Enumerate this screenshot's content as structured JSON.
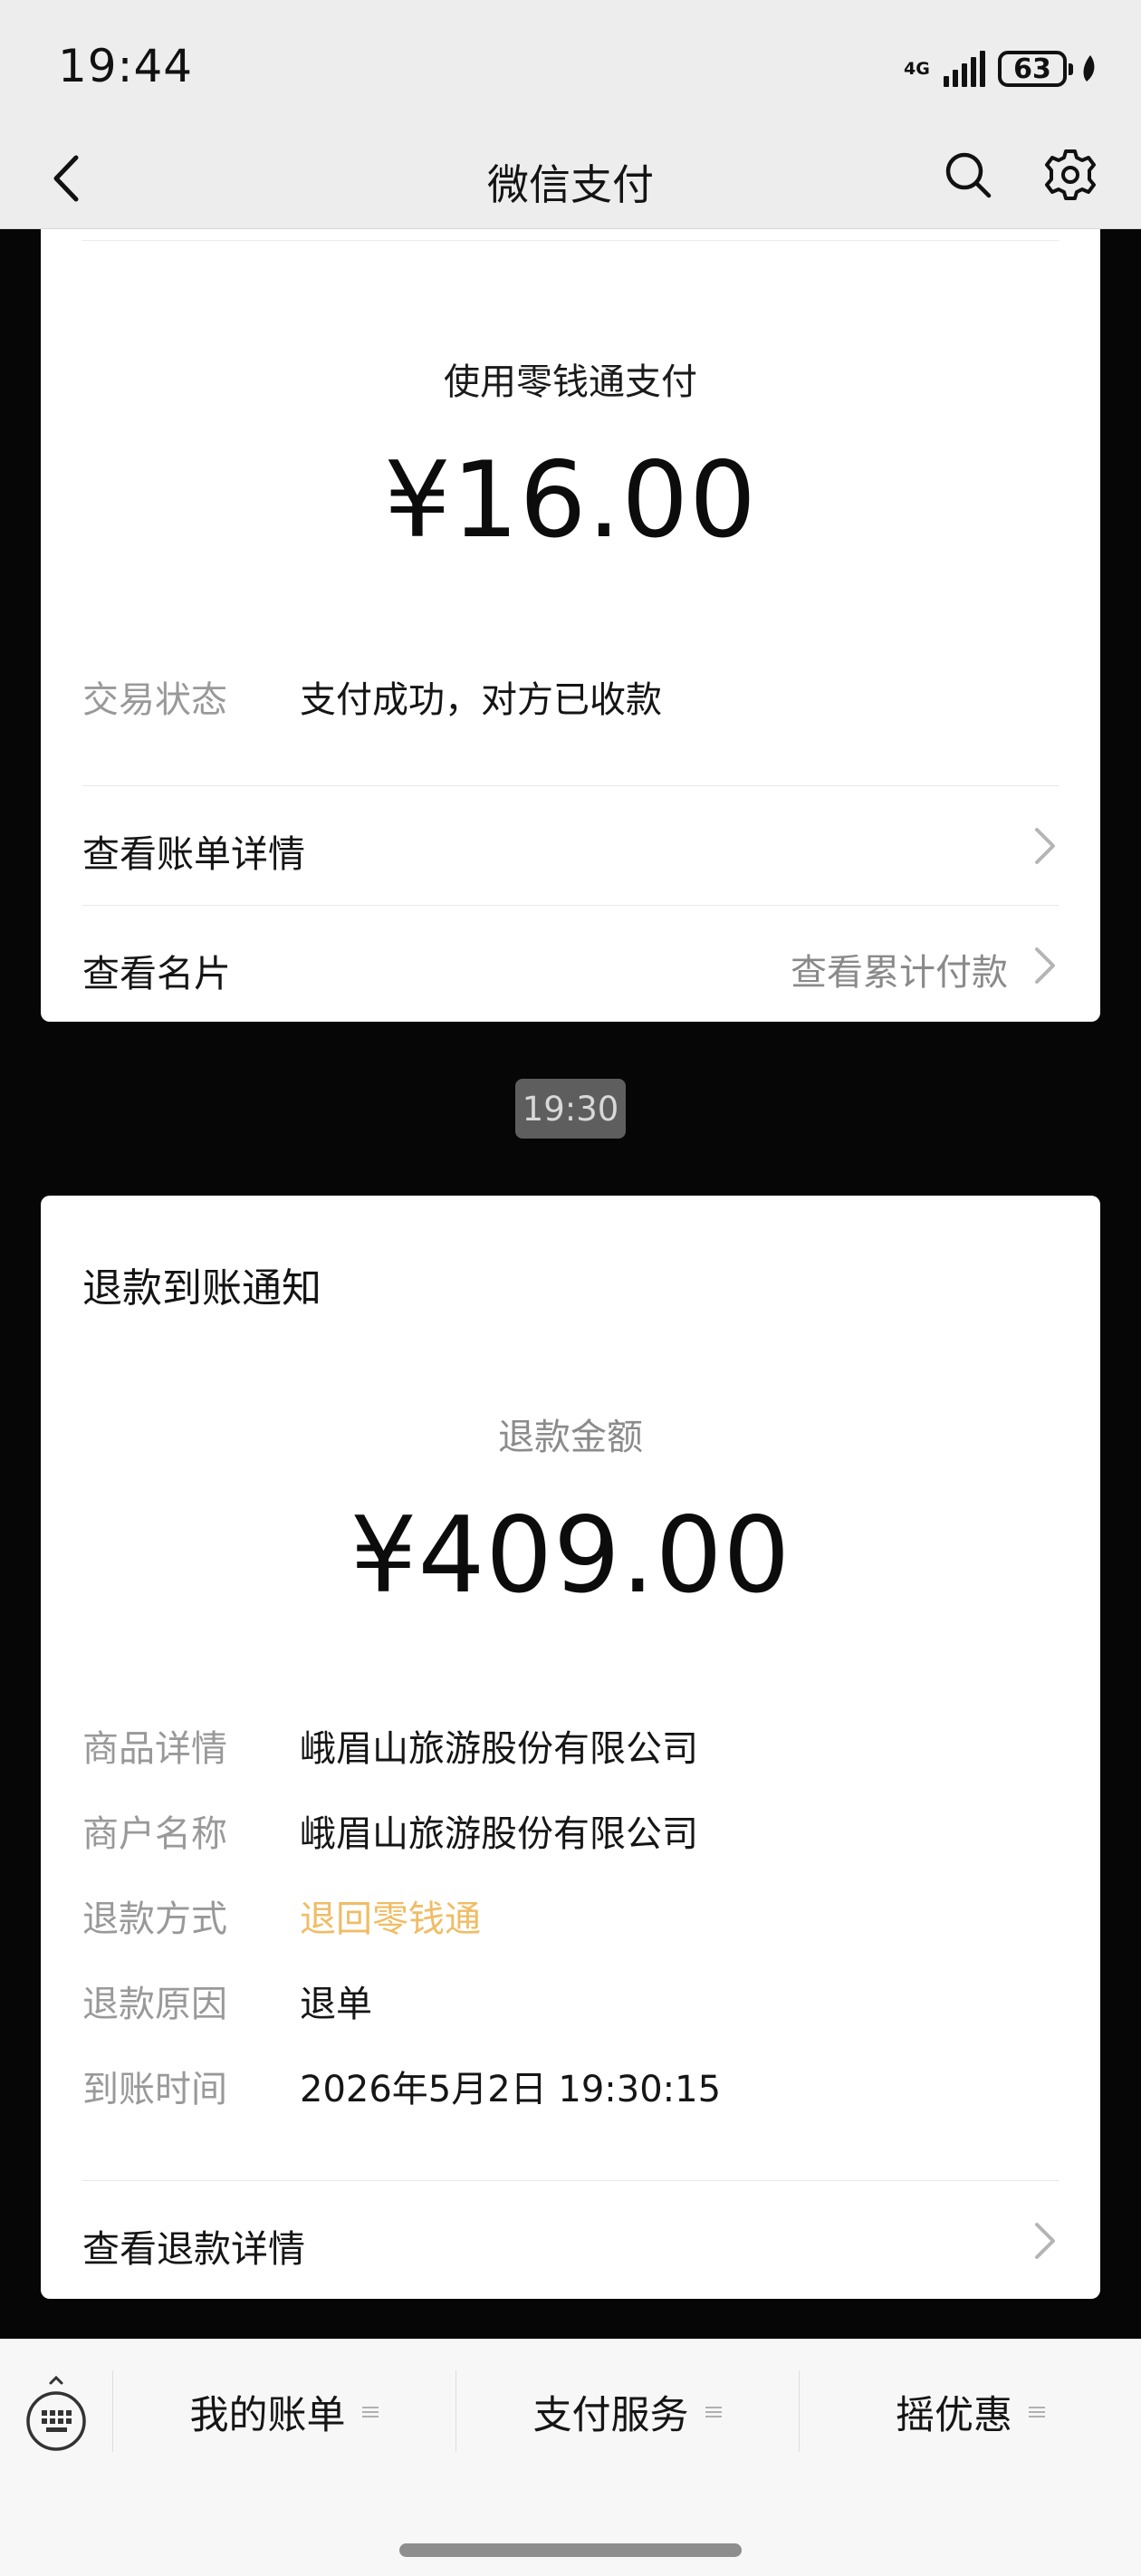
{
  "status_bar": {
    "time": "19:44",
    "network": "4G",
    "battery": "63"
  },
  "header": {
    "title": "微信支付"
  },
  "payment_card": {
    "method_label": "使用零钱通支付",
    "amount": "¥16.00",
    "status_label": "交易状态",
    "status_value": "支付成功，对方已收款",
    "links": {
      "bill_details": "查看账单详情",
      "business_card": "查看名片",
      "cumulative": "查看累计付款"
    }
  },
  "timestamp": "19:30",
  "refund_card": {
    "title": "退款到账通知",
    "amount_label": "退款金额",
    "amount": "¥409.00",
    "fields": [
      {
        "key": "商品详情",
        "value": "峨眉山旅游股份有限公司"
      },
      {
        "key": "商户名称",
        "value": "峨眉山旅游股份有限公司"
      },
      {
        "key": "退款方式",
        "value": "退回零钱通"
      },
      {
        "key": "退款原因",
        "value": "退单"
      },
      {
        "key": "到账时间",
        "value": "2026年5月2日 19:30:15"
      }
    ],
    "details_link": "查看退款详情",
    "accent_color": "#efbd66"
  },
  "bottom_menu": {
    "items": [
      {
        "label": "我的账单"
      },
      {
        "label": "支付服务"
      },
      {
        "label": "摇优惠"
      }
    ]
  }
}
